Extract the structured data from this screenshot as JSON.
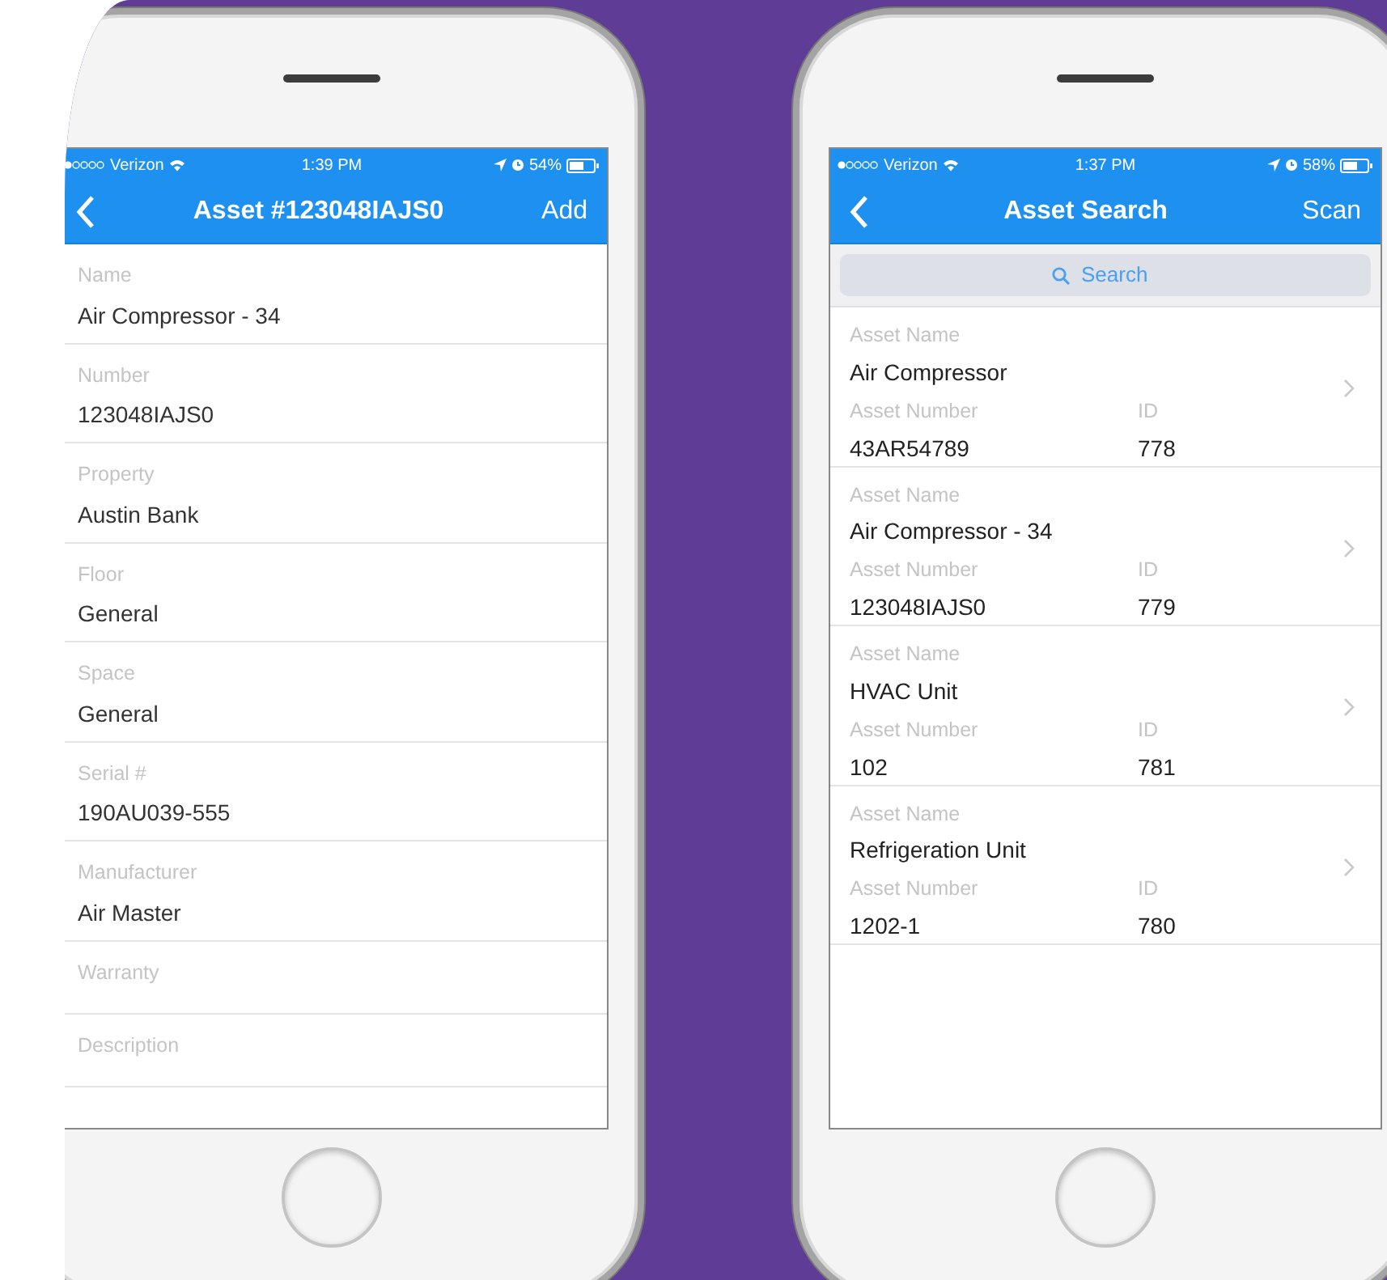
{
  "phones": [
    {
      "kind": "detail",
      "status": {
        "carrier": "Verizon",
        "time": "1:39 PM",
        "battery": "54%"
      },
      "nav": {
        "title": "Asset #123048IAJS0",
        "action": "Add"
      },
      "fields": [
        {
          "label": "Name",
          "value": "Air Compressor - 34"
        },
        {
          "label": "Number",
          "value": "123048IAJS0"
        },
        {
          "label": "Property",
          "value": "Austin Bank"
        },
        {
          "label": "Floor",
          "value": "General"
        },
        {
          "label": "Space",
          "value": "General"
        },
        {
          "label": "Serial #",
          "value": "190AU039-555"
        },
        {
          "label": "Manufacturer",
          "value": "Air Master"
        },
        {
          "label": "Warranty"
        },
        {
          "label": "Description"
        }
      ]
    },
    {
      "kind": "search",
      "status": {
        "carrier": "Verizon",
        "time": "1:37 PM",
        "battery": "58%"
      },
      "nav": {
        "title": "Asset Search",
        "action": "Scan"
      },
      "search": {
        "placeholder": "Search"
      },
      "results": [
        {
          "name_label": "Asset Name",
          "name": "Air Compressor",
          "number_label": "Asset Number",
          "number": "43AR54789",
          "id_label": "ID",
          "id": "778"
        },
        {
          "name_label": "Asset Name",
          "name": "Air Compressor - 34",
          "number_label": "Asset Number",
          "number": "123048IAJS0",
          "id_label": "ID",
          "id": "779"
        },
        {
          "name_label": "Asset Name",
          "name": "HVAC Unit",
          "number_label": "Asset Number",
          "number": "102",
          "id_label": "ID",
          "id": "781"
        },
        {
          "name_label": "Asset Name",
          "name": "Refrigeration Unit",
          "number_label": "Asset Number",
          "number": "1202-1",
          "id_label": "ID",
          "id": "780"
        }
      ]
    }
  ]
}
